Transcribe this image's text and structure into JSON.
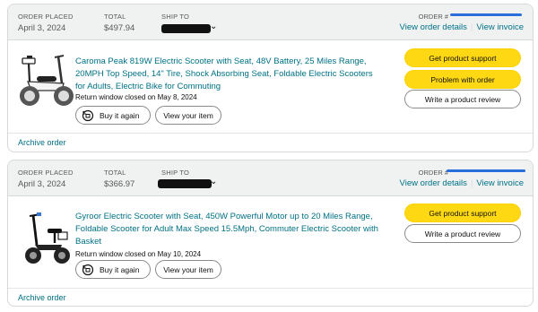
{
  "orders": [
    {
      "placed_label": "ORDER PLACED",
      "placed_date": "April 3, 2024",
      "total_label": "TOTAL",
      "total": "$497.94",
      "ship_to_label": "SHIP TO",
      "order_num_label": "ORDER #",
      "view_details": "View order details",
      "view_invoice": "View invoice",
      "product_title": "Caroma Peak 819W Electric Scooter with Seat, 48V Battery, 25 Miles Range, 20MPH Top Speed, 14\" Tire, Shock Absorbing Seat, Foldable Electric Scooters for Adults, Electric Bike for Commuting",
      "return_text": "Return window closed on May 8, 2024",
      "buy_again": "Buy it again",
      "view_item": "View your item",
      "actions": [
        "Get product support",
        "Problem with order",
        "Write a product review"
      ],
      "archive": "Archive order"
    },
    {
      "placed_label": "ORDER PLACED",
      "placed_date": "April 3, 2024",
      "total_label": "TOTAL",
      "total": "$366.97",
      "ship_to_label": "SHIP TO",
      "order_num_label": "ORDER #",
      "view_details": "View order details",
      "view_invoice": "View invoice",
      "product_title": "Gyroor Electric Scooter with Seat, 450W Powerful Motor up to 20 Miles Range, Foldable Scooter for Adult Max Speed 15.5Mph, Commuter Electric Scooter with Basket",
      "return_text": "Return window closed on May 10, 2024",
      "buy_again": "Buy it again",
      "view_item": "View your item",
      "actions": [
        "Get product support",
        "Write a product review"
      ],
      "archive": "Archive order"
    }
  ],
  "colors": {
    "link": "#007185",
    "primary_button": "#ffd814",
    "header_bg": "#f0f2f2",
    "redaction_blue": "#2a6edb"
  }
}
